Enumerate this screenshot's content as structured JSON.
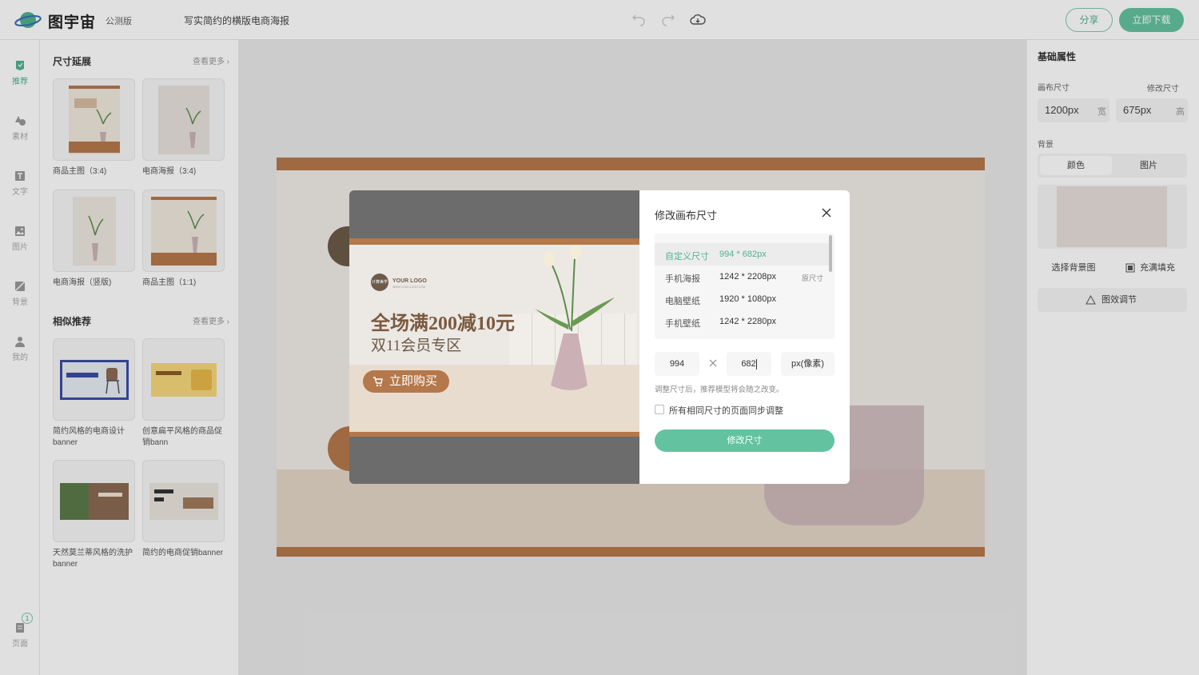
{
  "header": {
    "brand": "图宇宙",
    "edition": "公测版",
    "doc_title": "写实简约的横版电商海报",
    "share_label": "分享",
    "download_label": "立即下载"
  },
  "leftnav": {
    "items": [
      {
        "label": "推荐",
        "icon": "recommend-icon"
      },
      {
        "label": "素材",
        "icon": "shapes-icon"
      },
      {
        "label": "文字",
        "icon": "text-icon"
      },
      {
        "label": "图片",
        "icon": "image-icon"
      },
      {
        "label": "背景",
        "icon": "background-icon"
      },
      {
        "label": "我的",
        "icon": "user-icon"
      }
    ],
    "pages_label": "页面",
    "pages_count": "1"
  },
  "leftpanel": {
    "section1": {
      "title": "尺寸延展",
      "see_more": "查看更多",
      "items": [
        {
          "label": "商品主图（3:4)"
        },
        {
          "label": "电商海报（3:4)"
        },
        {
          "label": "电商海报（竖版)"
        },
        {
          "label": "商品主图（1:1)"
        }
      ]
    },
    "section2": {
      "title": "相似推荐",
      "see_more": "查看更多",
      "items": [
        {
          "label": "简约风格的电商设计banner"
        },
        {
          "label": "创意扁平风格的商品促销bann"
        },
        {
          "label": "天然莫兰蒂风格的洗护banner"
        },
        {
          "label": "简约的电商促销banner"
        }
      ]
    }
  },
  "poster": {
    "logo_text": "YOUR LOGO",
    "logo_sub": "WWW.YOUR.LOGO.COM",
    "badge_text": "计算美学",
    "headline": "全场满200减10元",
    "subline": "双11会员专区",
    "cta": "立即购买"
  },
  "rightpanel": {
    "title": "基础属性",
    "canvas_size_label": "画布尺寸",
    "modify_size_label": "修改尺寸",
    "width_value": "1200px",
    "width_unit": "宽",
    "height_value": "675px",
    "height_unit": "高",
    "background_label": "背景",
    "tab_color": "颜色",
    "tab_image": "图片",
    "choose_bg": "选择背景图",
    "fill_mode": "充满填充",
    "adjust": "图效调节"
  },
  "modal": {
    "title": "修改画布尺寸",
    "sizes": [
      {
        "name": "自定义尺寸",
        "dims": "994 * 682px",
        "tag": ""
      },
      {
        "name": "手机海报",
        "dims": "1242 * 2208px",
        "tag": "原尺寸"
      },
      {
        "name": "电脑壁纸",
        "dims": "1920 * 1080px",
        "tag": ""
      },
      {
        "name": "手机壁纸",
        "dims": "1242 * 2280px",
        "tag": ""
      }
    ],
    "width_input": "994",
    "height_input": "682",
    "unit": "px(像素)",
    "hint": "调整尺寸后，推荐模型将会随之改变。",
    "sync_label": "所有相同尺寸的页面同步调整",
    "submit": "修改尺寸"
  },
  "colors": {
    "accent": "#63c3a0",
    "brown": "#b5784b",
    "poster_bg": "#ece8e4"
  }
}
